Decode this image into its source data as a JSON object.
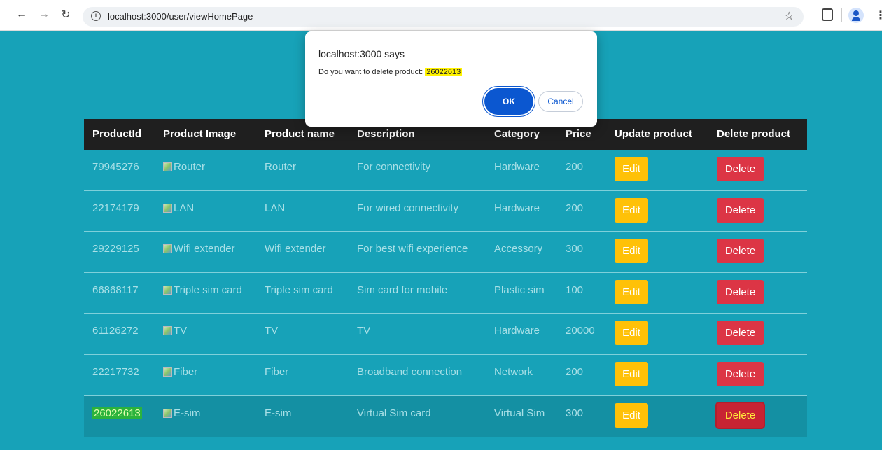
{
  "browser": {
    "url": "localhost:3000/user/viewHomePage"
  },
  "dialog": {
    "title": "localhost:3000 says",
    "message": "Do you want to delete product: ",
    "product_id": "26022613",
    "ok_label": "OK",
    "cancel_label": "Cancel"
  },
  "table": {
    "headers": [
      "ProductId",
      "Product Image",
      "Product name",
      "Description",
      "Category",
      "Price",
      "Update product",
      "Delete product"
    ],
    "edit_label": "Edit",
    "delete_label": "Delete",
    "rows": [
      {
        "id": "79945276",
        "image_alt": "Router",
        "name": "Router",
        "description": "For connectivity",
        "category": "Hardware",
        "price": "200"
      },
      {
        "id": "22174179",
        "image_alt": "LAN",
        "name": "LAN",
        "description": "For wired connectivity",
        "category": "Hardware",
        "price": "200"
      },
      {
        "id": "29229125",
        "image_alt": "Wifi extender",
        "name": "Wifi extender",
        "description": "For best wifi experience",
        "category": "Accessory",
        "price": "300"
      },
      {
        "id": "66868117",
        "image_alt": "Triple sim card",
        "name": "Triple sim card",
        "description": "Sim card for mobile",
        "category": "Plastic sim",
        "price": "100"
      },
      {
        "id": "61126272",
        "image_alt": "TV",
        "name": "TV",
        "description": "TV",
        "category": "Hardware",
        "price": "20000"
      },
      {
        "id": "22217732",
        "image_alt": "Fiber",
        "name": "Fiber",
        "description": "Broadband connection",
        "category": "Network",
        "price": "200"
      },
      {
        "id": "26022613",
        "image_alt": "E-sim",
        "name": "E-sim",
        "description": "Virtual Sim card",
        "category": "Virtual Sim",
        "price": "300"
      }
    ]
  },
  "colors": {
    "page_bg": "#17a2b8",
    "header_bg": "#1f1f1f",
    "edit_button": "#ffc107",
    "delete_button": "#dc3545",
    "ok_button": "#0b57d0"
  }
}
